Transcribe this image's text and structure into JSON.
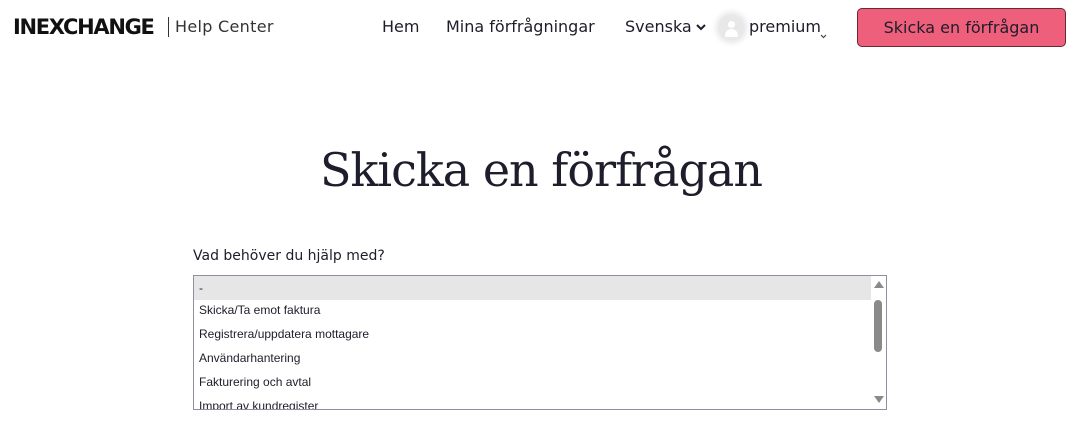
{
  "header": {
    "logo_text": "INEXCHANGE",
    "help_center": "Help Center",
    "nav": {
      "home": "Hem",
      "my_requests": "Mina förfrågningar",
      "language": "Svenska"
    },
    "user": {
      "name": "premium"
    },
    "cta_label": "Skicka en förfrågan",
    "cta_color": "#ee5f7b"
  },
  "icons": {
    "language_chevron": "chevron-down-icon",
    "user_chevron": "chevron-down-icon",
    "avatar": "user-avatar-icon"
  },
  "main": {
    "title": "Skicka en förfrågan",
    "field_label": "Vad behöver du hjälp med?",
    "options": [
      "-",
      "Skicka/Ta emot faktura",
      "Registrera/uppdatera mottagare",
      "Användarhantering",
      "Fakturering och avtal",
      "Import av kundregister"
    ],
    "selected_option": "-"
  }
}
